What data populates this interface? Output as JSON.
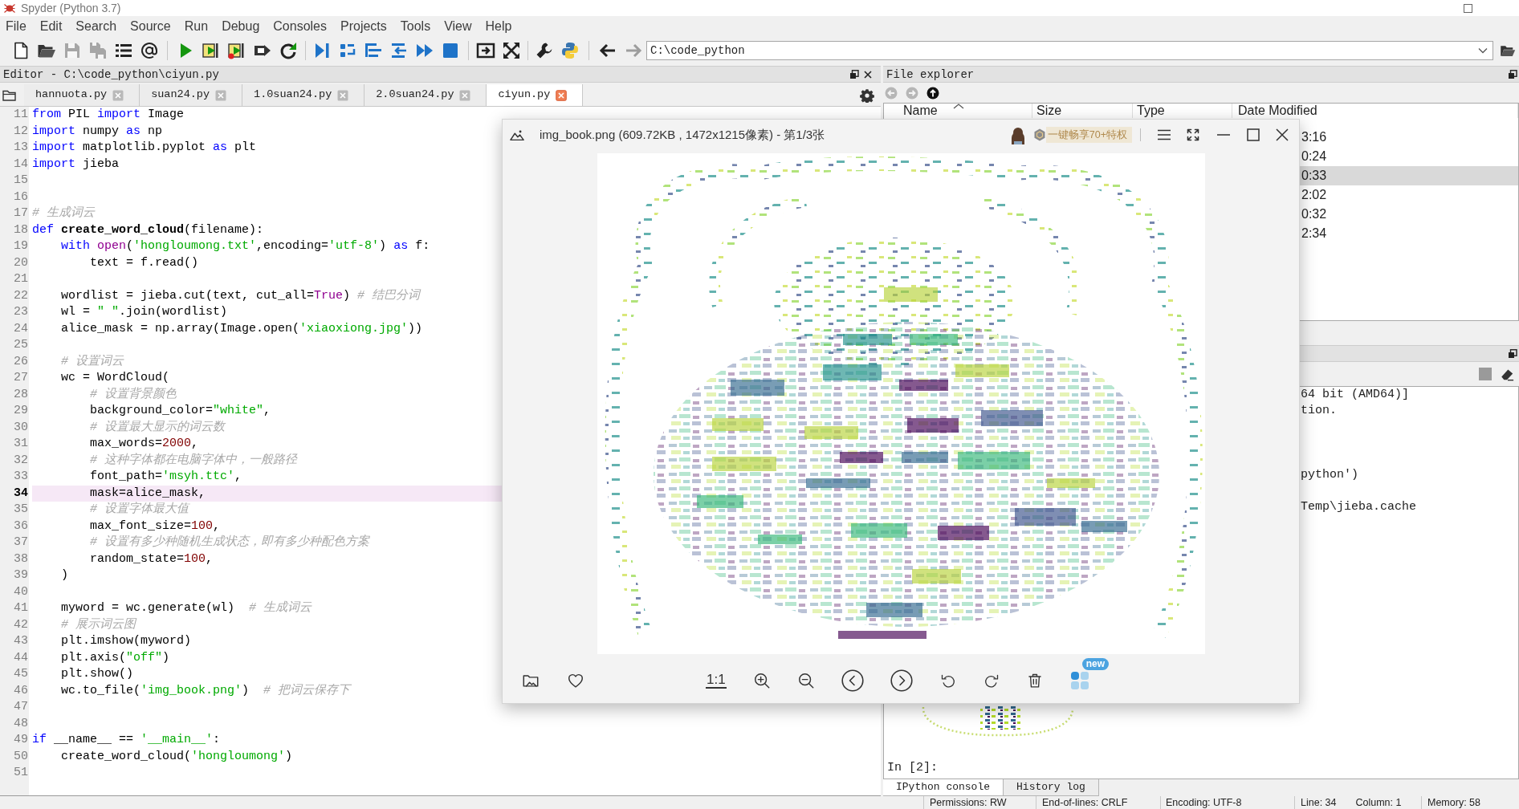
{
  "window": {
    "title": "Spyder (Python 3.7)"
  },
  "menu": [
    "File",
    "Edit",
    "Search",
    "Source",
    "Run",
    "Debug",
    "Consoles",
    "Projects",
    "Tools",
    "View",
    "Help"
  ],
  "toolbar": [
    {
      "disabled": false
    },
    {
      "disabled": false
    },
    {
      "disabled": true
    },
    {
      "disabled": true
    },
    {
      "disabled": false
    },
    {
      "disabled": false
    },
    {
      "disabled": false
    },
    {
      "disabled": false
    },
    {
      "disabled": false
    },
    {
      "disabled": false
    },
    {
      "disabled": false
    },
    {
      "disabled": false
    },
    {
      "disabled": false
    },
    {
      "disabled": false
    },
    {
      "disabled": false
    },
    {
      "disabled": false
    },
    {
      "disabled": false
    },
    {
      "disabled": false
    },
    {
      "disabled": false
    },
    {
      "disabled": false
    },
    {
      "disabled": false
    },
    {
      "disabled": false
    },
    {
      "disabled": true
    }
  ],
  "path_field": {
    "value": "C:\\code_python"
  },
  "editor": {
    "title": "Editor - C:\\code_python\\ciyun.py",
    "tabs": [
      {
        "label": "hannuota.py",
        "selected": false
      },
      {
        "label": "suan24.py",
        "selected": false
      },
      {
        "label": "1.0suan24.py",
        "selected": false
      },
      {
        "label": "2.0suan24.py",
        "selected": false
      },
      {
        "label": "ciyun.py",
        "selected": true
      }
    ],
    "lines": [
      {
        "number": "11",
        "current": false,
        "kind": "top",
        "tokens": [
          {
            "kind": "keyword",
            "text": "from"
          },
          {
            "kind": "plain",
            "text": " PIL "
          },
          {
            "kind": "keyword",
            "text": "import"
          },
          {
            "kind": "plain",
            "text": " Image"
          }
        ]
      },
      {
        "number": "12",
        "current": false,
        "kind": "top",
        "tokens": [
          {
            "kind": "keyword",
            "text": "import"
          },
          {
            "kind": "plain",
            "text": " numpy "
          },
          {
            "kind": "keyword",
            "text": "as"
          },
          {
            "kind": "plain",
            "text": " np"
          }
        ]
      },
      {
        "number": "13",
        "current": false,
        "kind": "top",
        "tokens": [
          {
            "kind": "keyword",
            "text": "import"
          },
          {
            "kind": "plain",
            "text": " matplotlib.pyplot "
          },
          {
            "kind": "keyword",
            "text": "as"
          },
          {
            "kind": "plain",
            "text": " plt"
          }
        ]
      },
      {
        "number": "14",
        "current": false,
        "kind": "top",
        "tokens": [
          {
            "kind": "keyword",
            "text": "import"
          },
          {
            "kind": "plain",
            "text": " jieba"
          }
        ]
      },
      {
        "number": "15",
        "current": false,
        "kind": "blank"
      },
      {
        "number": "16",
        "current": false,
        "kind": "blank"
      },
      {
        "number": "17",
        "current": false,
        "kind": "top",
        "tokens": [
          {
            "kind": "comment",
            "text": "# 生成词云"
          }
        ]
      },
      {
        "number": "18",
        "current": false,
        "kind": "top",
        "tokens": [
          {
            "kind": "keyword",
            "text": "def "
          },
          {
            "kind": "function",
            "text": "create_word_cloud"
          },
          {
            "kind": "plain",
            "text": "(filename):"
          }
        ]
      },
      {
        "number": "19",
        "current": false,
        "kind": "block",
        "tokens": [
          {
            "kind": "keyword",
            "text": "with "
          },
          {
            "kind": "builtin",
            "text": "open"
          },
          {
            "kind": "plain",
            "text": "("
          },
          {
            "kind": "string",
            "text": "'hongloumong.txt'"
          },
          {
            "kind": "plain",
            "text": ",encoding="
          },
          {
            "kind": "string",
            "text": "'utf-8'"
          },
          {
            "kind": "plain",
            "text": ") "
          },
          {
            "kind": "keyword",
            "text": "as"
          },
          {
            "kind": "plain",
            "text": " f:"
          }
        ]
      },
      {
        "number": "20",
        "current": false,
        "kind": "inner",
        "tokens": [
          {
            "kind": "plain",
            "text": "text = f.read()"
          }
        ]
      },
      {
        "number": "21",
        "current": false,
        "kind": "blank"
      },
      {
        "number": "22",
        "current": false,
        "kind": "block",
        "tokens": [
          {
            "kind": "plain",
            "text": "wordlist = jieba.cut(text, cut_all="
          },
          {
            "kind": "constant",
            "text": "True"
          },
          {
            "kind": "plain",
            "text": ") "
          },
          {
            "kind": "comment",
            "text": "# 结巴分词"
          }
        ]
      },
      {
        "number": "23",
        "current": false,
        "kind": "block",
        "tokens": [
          {
            "kind": "plain",
            "text": "wl = "
          },
          {
            "kind": "string",
            "text": "\" \""
          },
          {
            "kind": "plain",
            "text": ".join(wordlist)"
          }
        ]
      },
      {
        "number": "24",
        "current": false,
        "kind": "block",
        "tokens": [
          {
            "kind": "plain",
            "text": "alice_mask = np.array(Image.open("
          },
          {
            "kind": "string",
            "text": "'xiaoxiong.jpg'"
          },
          {
            "kind": "plain",
            "text": "))"
          }
        ]
      },
      {
        "number": "25",
        "current": false,
        "kind": "blank"
      },
      {
        "number": "26",
        "current": false,
        "kind": "block",
        "tokens": [
          {
            "kind": "comment",
            "text": "# 设置词云"
          }
        ]
      },
      {
        "number": "27",
        "current": false,
        "kind": "block",
        "tokens": [
          {
            "kind": "plain",
            "text": "wc = WordCloud("
          }
        ]
      },
      {
        "number": "28",
        "current": false,
        "kind": "inner",
        "tokens": [
          {
            "kind": "comment",
            "text": "# 设置背景颜色"
          }
        ]
      },
      {
        "number": "29",
        "current": false,
        "kind": "inner",
        "tokens": [
          {
            "kind": "plain",
            "text": "background_color="
          },
          {
            "kind": "string",
            "text": "\"white\""
          },
          {
            "kind": "plain",
            "text": ","
          }
        ]
      },
      {
        "number": "30",
        "current": false,
        "kind": "inner",
        "tokens": [
          {
            "kind": "comment",
            "text": "# 设置最大显示的词云数"
          }
        ]
      },
      {
        "number": "31",
        "current": false,
        "kind": "inner",
        "tokens": [
          {
            "kind": "plain",
            "text": "max_words="
          },
          {
            "kind": "number",
            "text": "2000"
          },
          {
            "kind": "plain",
            "text": ","
          }
        ]
      },
      {
        "number": "32",
        "current": false,
        "kind": "inner",
        "tokens": [
          {
            "kind": "comment",
            "text": "# 这种字体都在电脑字体中，一般路径"
          }
        ]
      },
      {
        "number": "33",
        "current": false,
        "kind": "inner",
        "tokens": [
          {
            "kind": "plain",
            "text": "font_path="
          },
          {
            "kind": "string",
            "text": "'msyh.ttc'"
          },
          {
            "kind": "plain",
            "text": ","
          }
        ]
      },
      {
        "number": "34",
        "current": true,
        "kind": "inner",
        "tokens": [
          {
            "kind": "plain",
            "text": "mask=alice_mask,"
          }
        ]
      },
      {
        "number": "35",
        "current": false,
        "kind": "inner",
        "tokens": [
          {
            "kind": "comment",
            "text": "# 设置字体最大值"
          }
        ]
      },
      {
        "number": "36",
        "current": false,
        "kind": "inner",
        "tokens": [
          {
            "kind": "plain",
            "text": "max_font_size="
          },
          {
            "kind": "number",
            "text": "100"
          },
          {
            "kind": "plain",
            "text": ","
          }
        ]
      },
      {
        "number": "37",
        "current": false,
        "kind": "inner",
        "tokens": [
          {
            "kind": "comment",
            "text": "# 设置有多少种随机生成状态，即有多少种配色方案"
          }
        ]
      },
      {
        "number": "38",
        "current": false,
        "kind": "inner",
        "tokens": [
          {
            "kind": "plain",
            "text": "random_state="
          },
          {
            "kind": "number",
            "text": "100"
          },
          {
            "kind": "plain",
            "text": ","
          }
        ]
      },
      {
        "number": "39",
        "current": false,
        "kind": "block",
        "tokens": [
          {
            "kind": "plain",
            "text": ")"
          }
        ]
      },
      {
        "number": "40",
        "current": false,
        "kind": "blank"
      },
      {
        "number": "41",
        "current": false,
        "kind": "block",
        "tokens": [
          {
            "kind": "plain",
            "text": "myword = wc.generate(wl)  "
          },
          {
            "kind": "comment",
            "text": "# 生成词云"
          }
        ]
      },
      {
        "number": "42",
        "current": false,
        "kind": "block",
        "tokens": [
          {
            "kind": "comment",
            "text": "# 展示词云图"
          }
        ]
      },
      {
        "number": "43",
        "current": false,
        "kind": "block",
        "tokens": [
          {
            "kind": "plain",
            "text": "plt.imshow(myword)"
          }
        ]
      },
      {
        "number": "44",
        "current": false,
        "kind": "block",
        "tokens": [
          {
            "kind": "plain",
            "text": "plt.axis("
          },
          {
            "kind": "string",
            "text": "\"off\""
          },
          {
            "kind": "plain",
            "text": ")"
          }
        ]
      },
      {
        "number": "45",
        "current": false,
        "kind": "block",
        "tokens": [
          {
            "kind": "plain",
            "text": "plt.show()"
          }
        ]
      },
      {
        "number": "46",
        "current": false,
        "kind": "block",
        "tokens": [
          {
            "kind": "plain",
            "text": "wc.to_file("
          },
          {
            "kind": "string",
            "text": "'img_book.png'"
          },
          {
            "kind": "plain",
            "text": ")  "
          },
          {
            "kind": "comment",
            "text": "# 把词云保存下"
          }
        ]
      },
      {
        "number": "47",
        "current": false,
        "kind": "blank"
      },
      {
        "number": "48",
        "current": false,
        "kind": "blank"
      },
      {
        "number": "49",
        "current": false,
        "kind": "top",
        "tokens": [
          {
            "kind": "keyword",
            "text": "if"
          },
          {
            "kind": "plain",
            "text": " __name__ == "
          },
          {
            "kind": "string",
            "text": "'__main__'"
          },
          {
            "kind": "plain",
            "text": ":"
          }
        ]
      },
      {
        "number": "50",
        "current": false,
        "kind": "block",
        "tokens": [
          {
            "kind": "plain",
            "text": "create_word_cloud("
          },
          {
            "kind": "string",
            "text": "'hongloumong'"
          },
          {
            "kind": "plain",
            "text": ")"
          }
        ]
      },
      {
        "number": "51",
        "current": false,
        "kind": "blank"
      }
    ]
  },
  "file_explorer": {
    "title": "File explorer",
    "nav": [
      {
        "disabled": true
      },
      {
        "disabled": true
      },
      {
        "disabled": false
      }
    ],
    "columns": [
      {
        "label": "Name",
        "sorted": true
      },
      {
        "label": "Size",
        "sorted": false
      },
      {
        "label": "Type",
        "sorted": false
      },
      {
        "label": "Date Modified",
        "sorted": false
      }
    ],
    "rows": [
      {
        "date_modified": "3:16",
        "selected": false
      },
      {
        "date_modified": "0:24",
        "selected": false
      },
      {
        "date_modified": "0:33",
        "selected": true
      },
      {
        "date_modified": "2:02",
        "selected": false
      },
      {
        "date_modified": "0:32",
        "selected": false
      },
      {
        "date_modified": "2:34",
        "selected": false
      }
    ]
  },
  "console": {
    "output": [
      {
        "text": "64 bit (AMD64)]"
      },
      {
        "text": "tion."
      },
      {
        "text": "python')"
      },
      {
        "text": "Temp\\jieba.cache"
      }
    ],
    "prompt": "In [2]:",
    "tabs": [
      {
        "label": "IPython console",
        "selected": true
      },
      {
        "label": "History log",
        "selected": false
      }
    ]
  },
  "image_viewer": {
    "title": "img_book.png (609.72KB , 1472x1215像素) - 第1/3张",
    "promo": "一键畅享70+特权",
    "actual_size": "1:1",
    "badge": "new"
  },
  "status_bar": {
    "permissions": "Permissions: RW",
    "end_of_lines": "End-of-lines: CRLF",
    "encoding": "Encoding: UTF-8",
    "line": "Line: 34",
    "column": "Column: 1",
    "memory": "Memory: 58"
  }
}
